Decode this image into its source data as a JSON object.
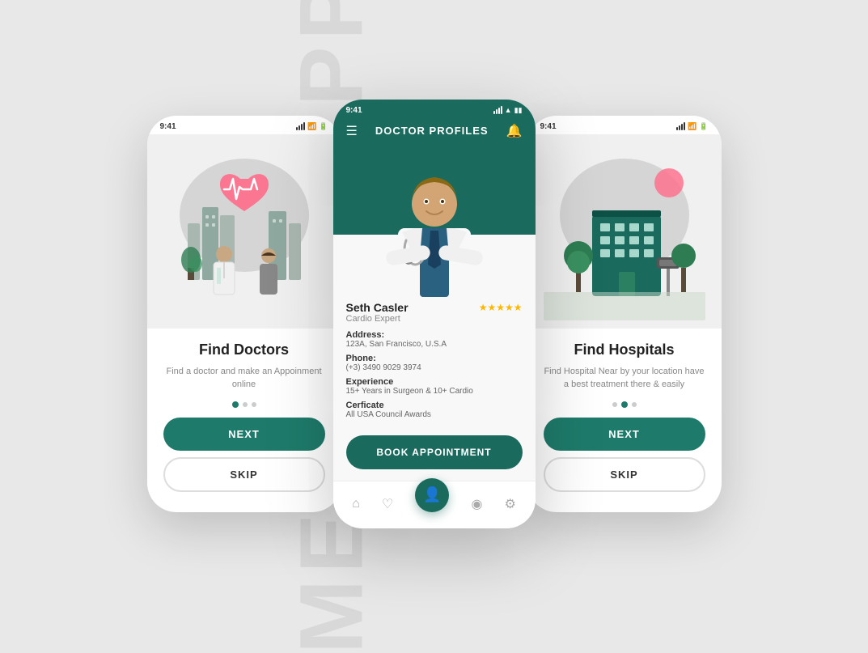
{
  "app": {
    "bg_label": "MEDICAL APP"
  },
  "phone_left": {
    "status_time": "9:41",
    "title": "Find Doctors",
    "subtitle": "Find a doctor and make an\nAppoinment online",
    "btn_next": "NEXT",
    "btn_skip": "SKIP"
  },
  "phone_middle": {
    "status_time": "9:41",
    "header_title": "DOCTOR PROFILES",
    "doctor_name": "Seth Casler",
    "doctor_specialty": "Cardio Expert",
    "address_label": "Address:",
    "address_value": "123A, San Francisco, U.S.A",
    "phone_label": "Phone:",
    "phone_value": "(+3) 3490 9029 3974",
    "experience_label": "Experience",
    "experience_value": "15+ Years in Surgeon & 10+ Cardio",
    "certificate_label": "Cerficate",
    "certificate_value": "All USA Council Awards",
    "book_btn": "BOOK APPOINTMENT",
    "stars": "★★★★★"
  },
  "phone_right": {
    "status_time": "9:41",
    "title": "Find Hospitals",
    "subtitle": "Find Hospital Near by your location\nhave a best treatment there & easily",
    "btn_next": "NEXT",
    "btn_skip": "SKIP"
  },
  "colors": {
    "primary": "#1a6b5e",
    "star": "#FFB800",
    "bg": "#e8e8e8",
    "text_dark": "#222",
    "text_muted": "#888"
  }
}
